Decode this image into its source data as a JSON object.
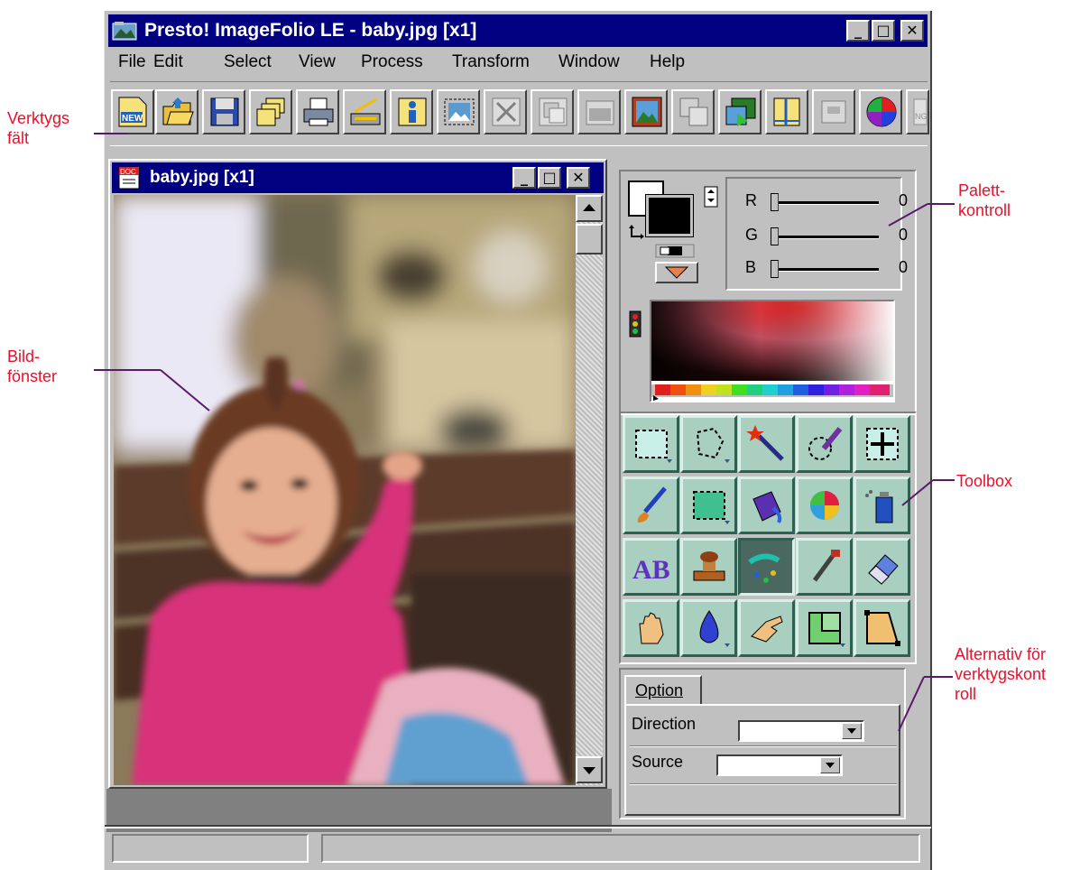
{
  "window": {
    "title": "Presto! ImageFolio LE - baby.jpg [x1]",
    "min_glyph": "_",
    "max_glyph": "□",
    "close_glyph": "✕"
  },
  "menu": {
    "items": [
      {
        "label": "File"
      },
      {
        "label": "Edit"
      },
      {
        "label": "Select"
      },
      {
        "label": "View"
      },
      {
        "label": "Process"
      },
      {
        "label": "Transform"
      },
      {
        "label": "Window"
      },
      {
        "label": "Help"
      }
    ]
  },
  "toolbar": {
    "buttons": [
      {
        "icon": "new-document-icon",
        "text": "NEW"
      },
      {
        "icon": "open-folder-icon"
      },
      {
        "icon": "save-disk-icon"
      },
      {
        "icon": "file-manager-icon"
      },
      {
        "icon": "print-icon"
      },
      {
        "icon": "scan-icon"
      },
      {
        "icon": "image-info-icon"
      },
      {
        "icon": "select-all-icon"
      },
      {
        "icon": "cut-icon"
      },
      {
        "icon": "copy-icon"
      },
      {
        "icon": "paste-icon"
      },
      {
        "icon": "frame-image-icon"
      },
      {
        "icon": "duplicate-icon"
      },
      {
        "icon": "export-icon"
      },
      {
        "icon": "ruler-icon"
      },
      {
        "icon": "twain-icon"
      },
      {
        "icon": "color-wheel-icon"
      },
      {
        "icon": "stop-hand-icon",
        "text": "NG"
      }
    ]
  },
  "document": {
    "title": "baby.jpg [x1]",
    "doc_icon_text": "DOC"
  },
  "palette": {
    "foreground_color": "#000000",
    "background_color": "#ffffff",
    "sliders": [
      {
        "label": "R",
        "value": "0"
      },
      {
        "label": "G",
        "value": "0"
      },
      {
        "label": "B",
        "value": "0"
      }
    ]
  },
  "toolbox": {
    "tools": [
      {
        "icon": "rectangle-select-icon"
      },
      {
        "icon": "lasso-select-icon"
      },
      {
        "icon": "magic-wand-icon"
      },
      {
        "icon": "paint-select-icon"
      },
      {
        "icon": "move-icon"
      },
      {
        "icon": "paintbrush-icon"
      },
      {
        "icon": "rectangle-fill-icon"
      },
      {
        "icon": "paint-bucket-icon"
      },
      {
        "icon": "color-ball-icon"
      },
      {
        "icon": "spray-can-icon"
      },
      {
        "icon": "text-tool-icon",
        "text": "AB"
      },
      {
        "icon": "stamp-icon"
      },
      {
        "icon": "smudge-icon"
      },
      {
        "icon": "eyedropper-icon"
      },
      {
        "icon": "eraser-icon"
      },
      {
        "icon": "hand-pan-icon"
      },
      {
        "icon": "water-drop-icon"
      },
      {
        "icon": "finger-smudge-icon"
      },
      {
        "icon": "crop-icon"
      },
      {
        "icon": "perspective-icon"
      }
    ],
    "active_index": 12
  },
  "options": {
    "tab_label": "Option",
    "direction_label": "Direction",
    "direction_value": "",
    "source_label": "Source",
    "source_value": ""
  },
  "annotations": {
    "toolbar_line1": "Verktygs",
    "toolbar_line2": "fält",
    "image_line1": "Bild-",
    "image_line2": "fönster",
    "palette_line1": "Palett-",
    "palette_line2": "kontroll",
    "toolbox": "Toolbox",
    "options_line1": "Alternativ för",
    "options_line2": "verktygskont",
    "options_line3": "roll"
  },
  "colors": {
    "titlebar": "#000080",
    "annotation": "#e8102a",
    "annotation_line": "#5a1a6a",
    "tool_face": "#a8cfc0"
  }
}
